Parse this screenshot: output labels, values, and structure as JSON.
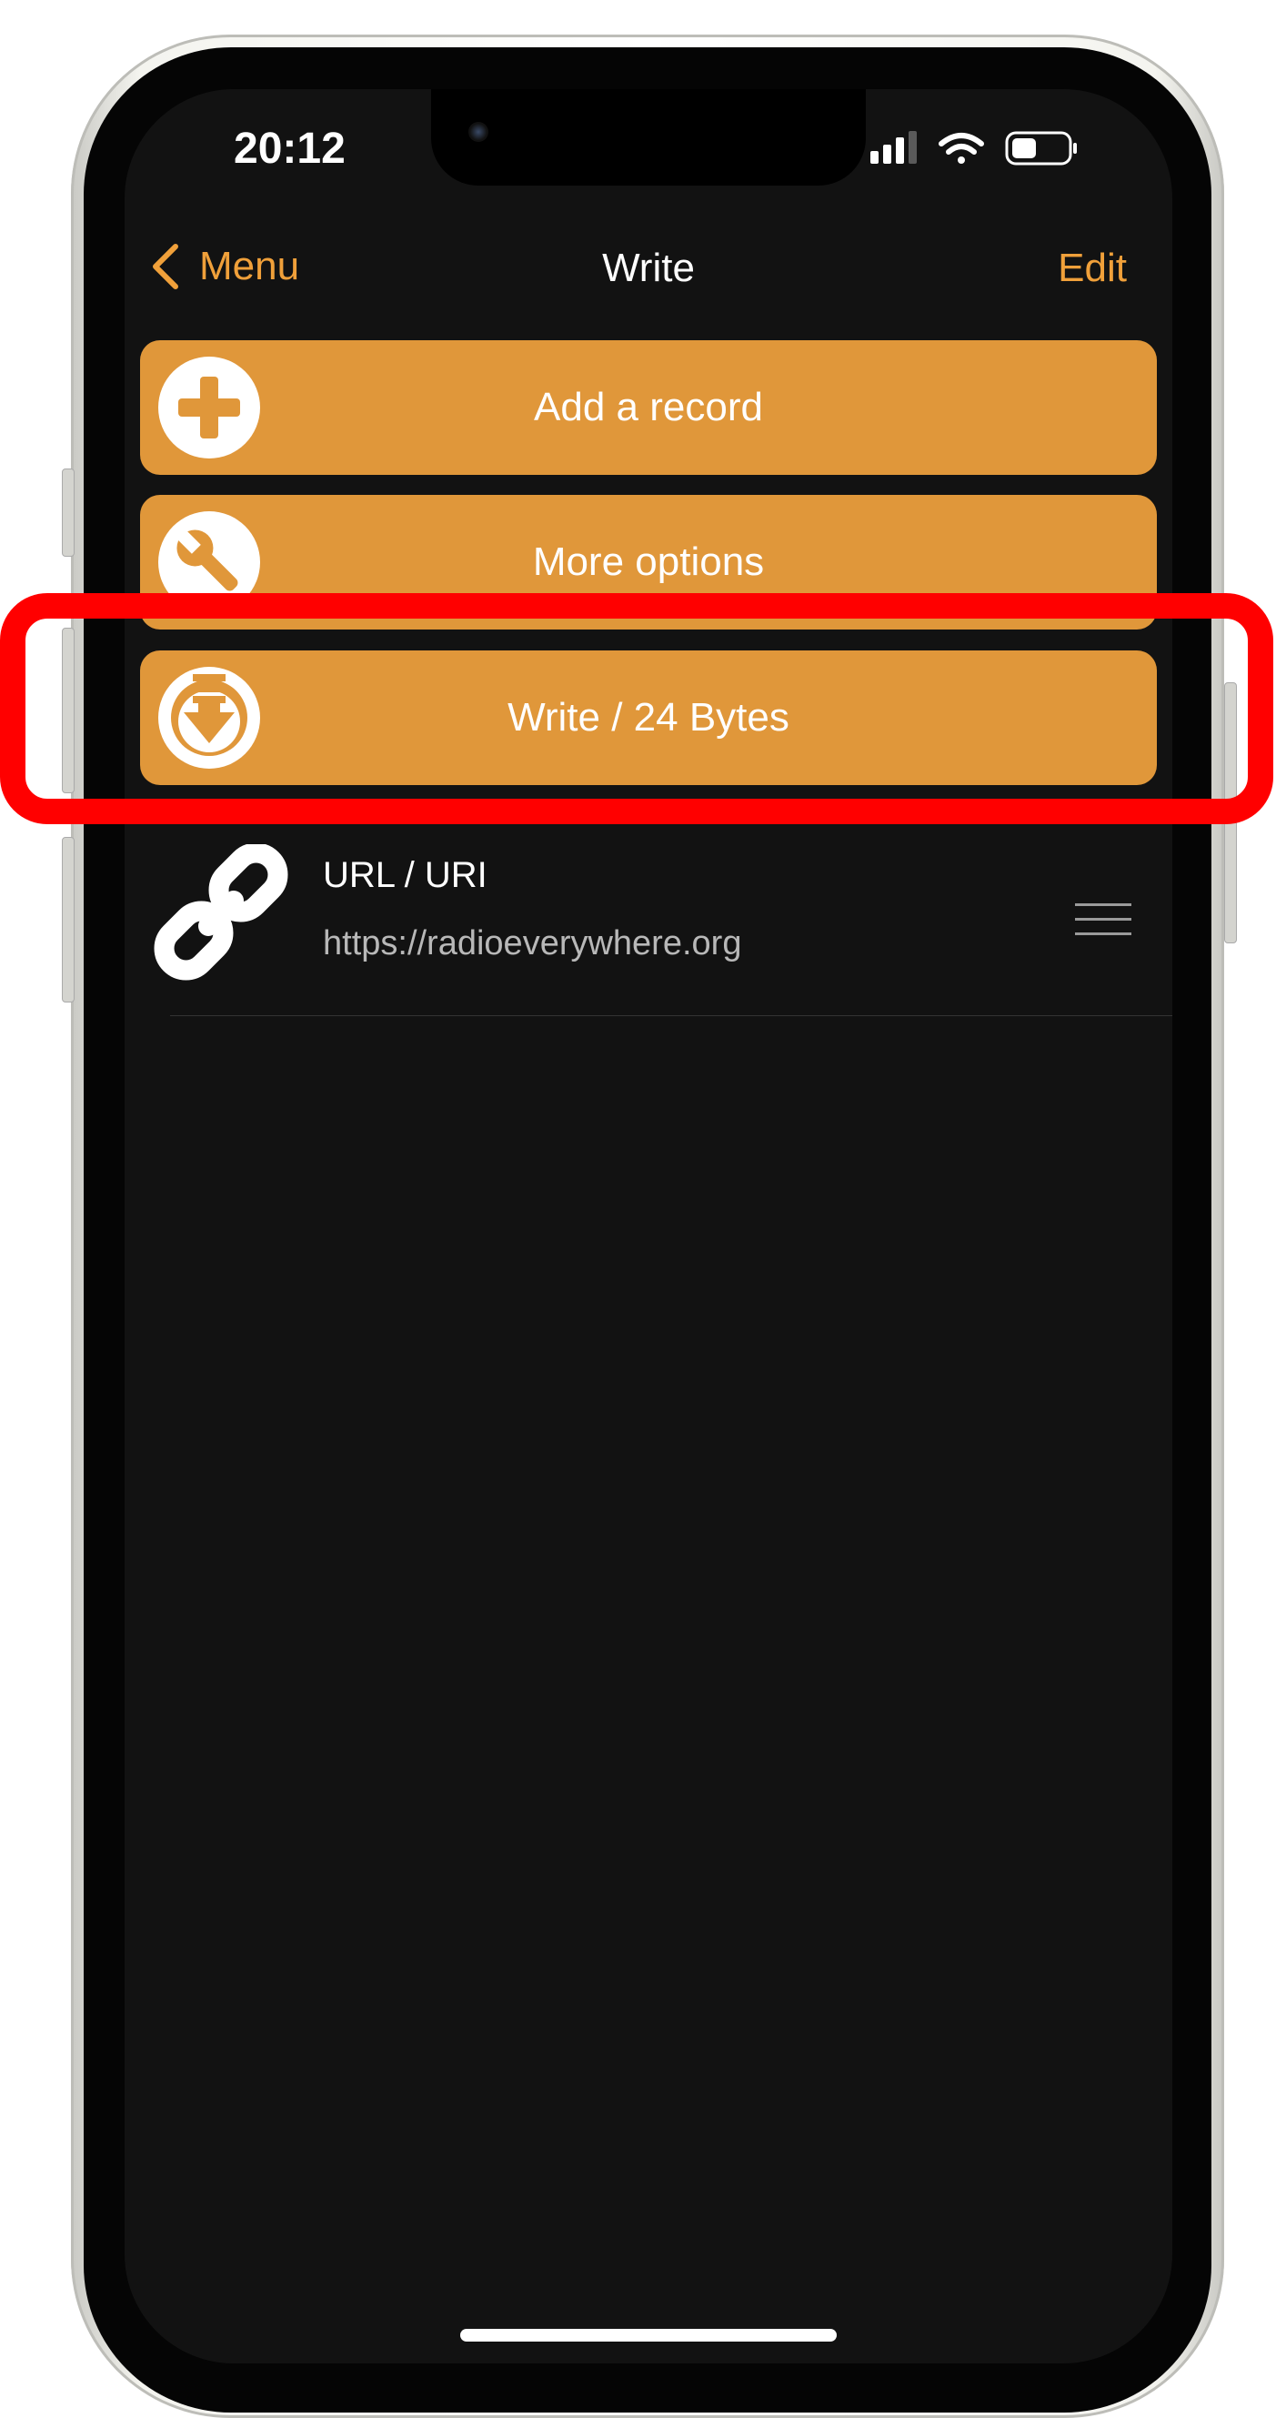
{
  "status_bar": {
    "time": "20:12",
    "icons": [
      "cellular-signal-icon",
      "wifi-icon",
      "battery-icon"
    ]
  },
  "nav": {
    "back_label": "Menu",
    "title": "Write",
    "edit_label": "Edit"
  },
  "actions": [
    {
      "label": "Add a record",
      "icon": "plus-circle-icon"
    },
    {
      "label": "More options",
      "icon": "wrench-icon"
    },
    {
      "label": "Write / 24 Bytes",
      "icon": "write-download-icon"
    }
  ],
  "records": [
    {
      "type": "URL / URI",
      "value": "https://radioeverywhere.org",
      "icon": "link-icon"
    }
  ],
  "colors": {
    "accent": "#f0a03a",
    "button": "#e0973a",
    "background": "#121212",
    "highlight": "#ff0000"
  }
}
